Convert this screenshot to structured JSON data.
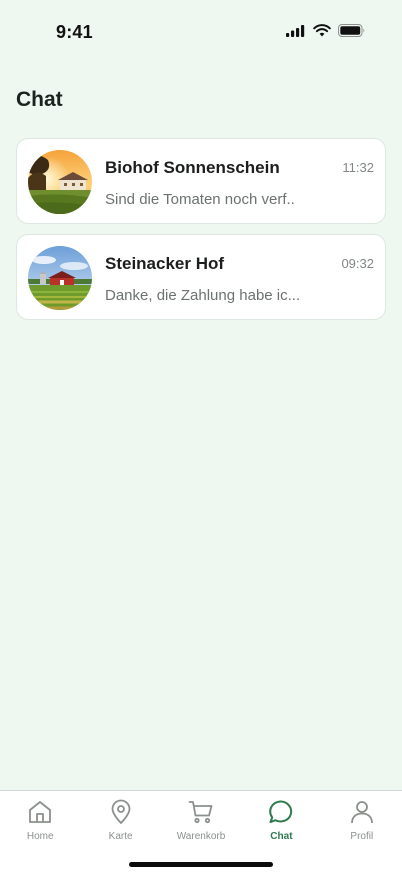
{
  "status_bar": {
    "time": "9:41",
    "icons": [
      "cellular-signal-icon",
      "wifi-icon",
      "battery-icon"
    ]
  },
  "page": {
    "title": "Chat"
  },
  "chats": [
    {
      "name": "Biohof Sonnenschein",
      "time": "11:32",
      "preview": "Sind die Tomaten noch verf..",
      "avatar": "farmhouse-sunset-avatar"
    },
    {
      "name": "Steinacker Hof",
      "time": "09:32",
      "preview": "Danke, die Zahlung habe ic...",
      "avatar": "red-barn-field-avatar"
    }
  ],
  "tab_bar": {
    "active": "chat",
    "tabs": [
      {
        "id": "home",
        "label": "Home",
        "icon": "home-icon"
      },
      {
        "id": "karte",
        "label": "Karte",
        "icon": "map-pin-icon"
      },
      {
        "id": "warenkorb",
        "label": "Warenkorb",
        "icon": "cart-icon"
      },
      {
        "id": "chat",
        "label": "Chat",
        "icon": "chat-bubble-icon"
      },
      {
        "id": "profil",
        "label": "Profil",
        "icon": "user-icon"
      }
    ]
  },
  "colors": {
    "background": "#eef7f0",
    "accent": "#2f7a4f",
    "inactive_tab": "#8a908c",
    "card": "#ffffff"
  }
}
